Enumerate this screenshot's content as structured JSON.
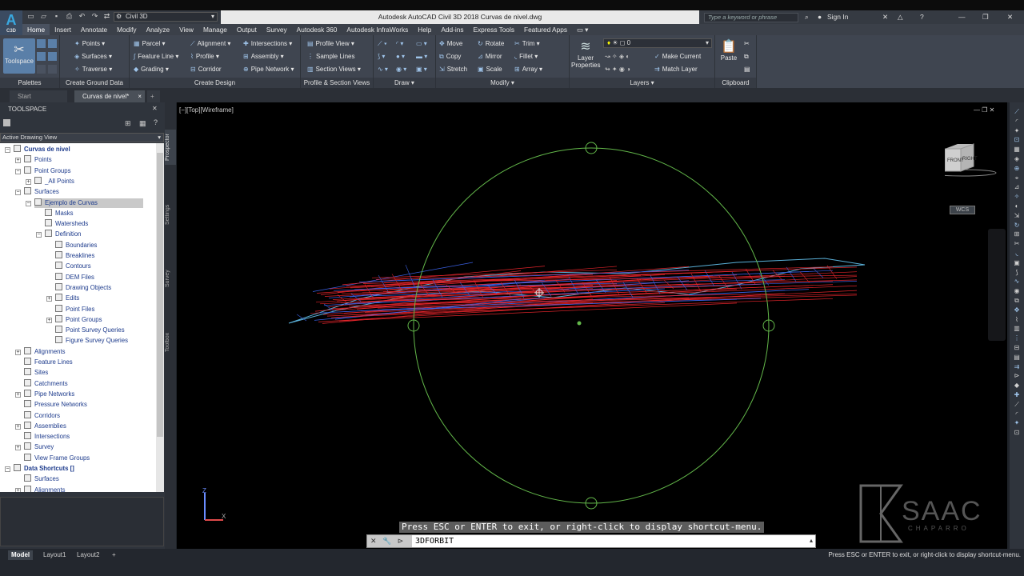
{
  "app": {
    "logo_text": "A",
    "logo_sub": "C3D",
    "workspace": "Civil 3D",
    "title": "Autodesk AutoCAD Civil 3D 2018    Curvas de nivel.dwg",
    "search_placeholder": "Type a keyword or phrase",
    "sign_in": "Sign In"
  },
  "ribbon_tabs": [
    "Home",
    "Insert",
    "Annotate",
    "Modify",
    "Analyze",
    "View",
    "Manage",
    "Output",
    "Survey",
    "Autodesk 360",
    "Autodesk InfraWorks",
    "Help",
    "Add-ins",
    "Express Tools",
    "Featured Apps"
  ],
  "panels": {
    "palettes": {
      "title": "Palettes",
      "big": "Toolspace"
    },
    "ground": {
      "title": "Create Ground Data",
      "items": [
        "Points",
        "Surfaces",
        "Traverse"
      ]
    },
    "design": {
      "title": "Create Design",
      "items": [
        "Parcel",
        "Feature Line",
        "Grading",
        "Alignment",
        "Profile",
        "Corridor",
        "Intersections",
        "Assembly",
        "Pipe Network"
      ]
    },
    "profile": {
      "title": "Profile & Section Views",
      "items": [
        "Profile View",
        "Sample Lines",
        "Section Views"
      ]
    },
    "draw": {
      "title": "Draw"
    },
    "modify": {
      "title": "Modify",
      "items": [
        "Move",
        "Copy",
        "Stretch",
        "Rotate",
        "Mirror",
        "Scale",
        "Trim",
        "Fillet",
        "Array"
      ]
    },
    "layers": {
      "title": "Layers",
      "big": "Layer Properties",
      "layer_value": "0",
      "items": [
        "Make Current",
        "Match Layer"
      ]
    },
    "clipboard": {
      "title": "Clipboard",
      "big": "Paste"
    }
  },
  "doc_tabs": [
    "Start",
    "Curvas de nivel*"
  ],
  "toolspace": {
    "title": "TOOLSPACE",
    "view_combo": "Active Drawing View",
    "side_tabs": [
      "Prospector",
      "Settings",
      "Survey",
      "Toolbox"
    ],
    "tree": [
      "Curvas de nivel",
      "Points",
      "Point Groups",
      "_All Points",
      "Surfaces",
      "Ejemplo de Curvas",
      "Masks",
      "Watersheds",
      "Definition",
      "Boundaries",
      "Breaklines",
      "Contours",
      "DEM Files",
      "Drawing Objects",
      "Edits",
      "Point Files",
      "Point Groups",
      "Point Survey Queries",
      "Figure Survey Queries",
      "Alignments",
      "Feature Lines",
      "Sites",
      "Catchments",
      "Pipe Networks",
      "Pressure Networks",
      "Corridors",
      "Assemblies",
      "Intersections",
      "Survey",
      "View Frame Groups",
      "Data Shortcuts []",
      "Surfaces",
      "Alignments"
    ]
  },
  "viewport": {
    "label": "[−][Top][Wireframe]",
    "cube_front": "FRONT",
    "cube_right": "RIGHT",
    "wcs": "WCS",
    "ucs_z": "Z",
    "ucs_x": "X"
  },
  "command": {
    "message": "Press ESC or ENTER to exit, or right-click to display shortcut-menu.",
    "text": "3DFORBIT"
  },
  "layout_tabs": [
    "Model",
    "Layout1",
    "Layout2"
  ],
  "status_message": "Press ESC or ENTER to exit, or right-click to display shortcut-menu.",
  "watermark": {
    "line1": "SAAC",
    "line2": "CHAPARRO"
  },
  "colors": {
    "orbit": "#63b84a",
    "surface_red": "#e0242a",
    "surface_blue": "#3a5fe0",
    "tin": "#5ab0d8"
  }
}
